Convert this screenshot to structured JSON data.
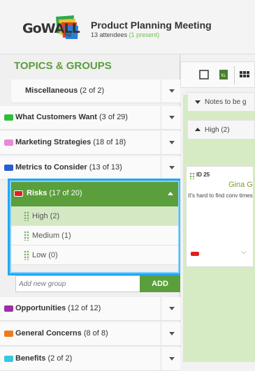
{
  "header": {
    "logo_text": "GoWALL",
    "logo_tm": "TM",
    "meeting_title": "Product Planning Meeting",
    "attendees": "13 attendees",
    "present": "(1 present)"
  },
  "sidebar": {
    "title": "TOPICS & GROUPS",
    "groups_above": [
      {
        "name": "Miscellaneous",
        "count": "(2 of 2)",
        "color": null,
        "bold": false
      },
      {
        "name": "What Customers Want",
        "count": "(3 of 29)",
        "color": "#2fbf3b",
        "bold": true
      },
      {
        "name": "Marketing Strategies",
        "count": "(18 of 18)",
        "color": "#e88ad8",
        "bold": true
      },
      {
        "name": "Metrics to Consider",
        "count": "(13 of 13)",
        "color": "#2a5bd7",
        "bold": true
      }
    ],
    "active_group": {
      "name": "Risks",
      "count": "(17 of 20)",
      "color": "#e02020"
    },
    "sub_items": [
      {
        "label": "High (2)",
        "active": true
      },
      {
        "label": "Medium (1)",
        "active": false
      },
      {
        "label": "Low (0)",
        "active": false
      }
    ],
    "add_placeholder": "Add new group",
    "add_button": "ADD",
    "groups_below": [
      {
        "name": "Opportunities",
        "count": "(12 of 12)",
        "color": "#9b2fa8",
        "bold": true
      },
      {
        "name": "General Concerns",
        "count": "(8 of 8)",
        "color": "#f07a1a",
        "bold": true
      },
      {
        "name": "Benefits",
        "count": "(2 of 2)",
        "color": "#33c9e0",
        "bold": true
      }
    ]
  },
  "main": {
    "notes_row": "Notes to be g",
    "high_row": "High (2)",
    "card": {
      "id": "ID 25",
      "author": "Gina Go",
      "body": "It's hard to find conv times for the teams",
      "tag_color": "#e02020"
    }
  },
  "colors": {
    "accent": "#5b9e3c",
    "highlight": "#21a8f0"
  }
}
